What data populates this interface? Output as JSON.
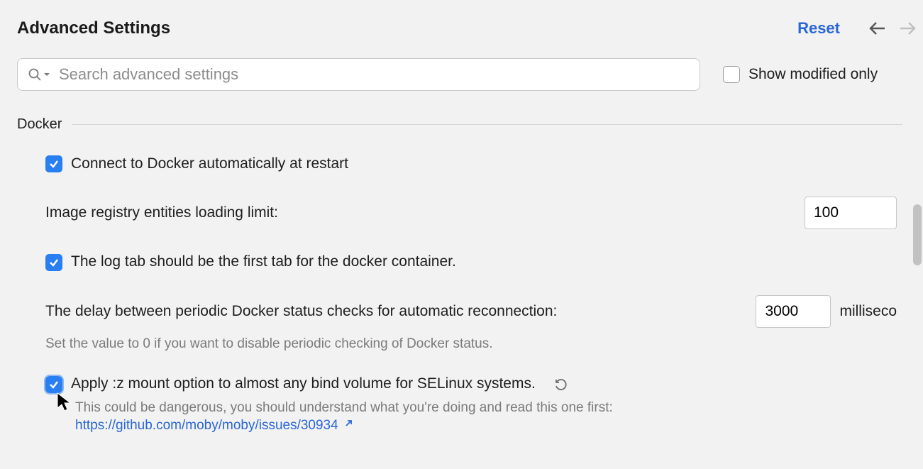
{
  "header": {
    "title": "Advanced Settings",
    "reset_label": "Reset"
  },
  "search": {
    "placeholder": "Search advanced settings",
    "value": ""
  },
  "show_modified_only": {
    "label": "Show modified only",
    "checked": false
  },
  "section": {
    "name": "Docker",
    "settings": {
      "connect_restart": {
        "label": "Connect to Docker automatically at restart",
        "checked": true
      },
      "registry_limit": {
        "label": "Image registry entities loading limit:",
        "value": "100"
      },
      "log_tab_first": {
        "label": "The log tab should be the first tab for the docker container.",
        "checked": true
      },
      "status_delay": {
        "label": "The delay between periodic Docker status checks for automatic reconnection:",
        "value": "3000",
        "unit": "milliseco",
        "help": "Set the value to 0 if you want to disable periodic checking of Docker status."
      },
      "selinux_z": {
        "label": "Apply :z mount option to almost any bind volume for SELinux systems.",
        "checked": true,
        "help_prefix": "This could be dangerous, you should understand what you're doing and read this one first:",
        "link_text": "https://github.com/moby/moby/issues/30934"
      }
    }
  }
}
